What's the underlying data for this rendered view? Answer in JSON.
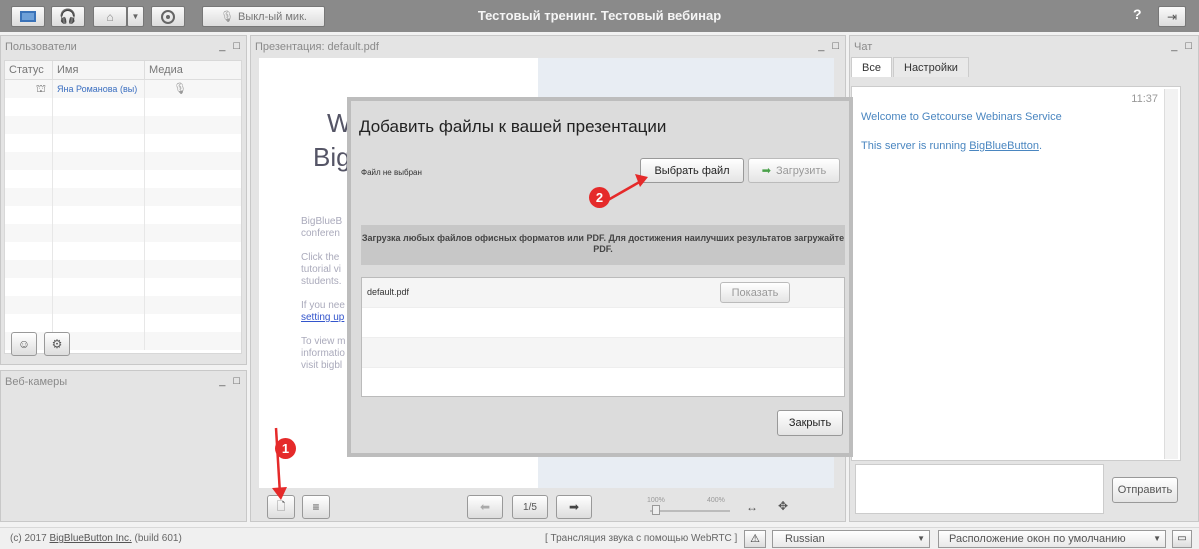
{
  "topbar": {
    "mic_button_label": "Выкл-ый мик.",
    "title": "Тестовый тренинг. Тестовый вебинар",
    "help_label": "?"
  },
  "users_panel": {
    "title": "Пользователи",
    "columns": [
      "Статус",
      "Имя",
      "Медиа"
    ],
    "rows": [
      {
        "name": "Яна Романова (вы)"
      }
    ]
  },
  "webcams_panel": {
    "title": "Веб-камеры"
  },
  "presentation_panel": {
    "title": "Презентация: default.pdf",
    "slide_heading_1": "W",
    "slide_heading_2": "Big",
    "slide_lines": [
      "BigBlueB",
      "conferen",
      "",
      "Click the",
      "tutorial vi",
      "students.",
      "",
      "If you nee",
      "setting up",
      "",
      "To view m",
      "informatio",
      "visit bigbl"
    ],
    "page_indicator": "1/5",
    "zoom_min": "100%",
    "zoom_max": "400%"
  },
  "chat_panel": {
    "title": "Чат",
    "tabs": [
      "Все",
      "Настройки"
    ],
    "timestamp": "11:37",
    "messages": [
      "Welcome to Getcourse Webinars Service",
      "This server is running "
    ],
    "link_text": "BigBlueButton",
    "link_suffix": ".",
    "send_label": "Отправить"
  },
  "modal": {
    "title": "Добавить файлы к вашей презентации",
    "file_status": "Файл не выбран",
    "choose_label": "Выбрать файл",
    "upload_label": "Загрузить",
    "info_text": "Загрузка любых файлов офисных форматов или PDF. Для достижения наилучших результатов загружайте PDF.",
    "files": [
      {
        "name": "default.pdf",
        "action": "Показать"
      }
    ],
    "close_label": "Закрыть"
  },
  "statusbar": {
    "copyright_prefix": "(c) 2017 ",
    "copyright_link": "BigBlueButton Inc.",
    "copyright_suffix": " (build 601)",
    "audio_text": "[ Трансляция звука с помощью WebRTC ]",
    "language": "Russian",
    "layout": "Расположение окон по умолчанию"
  },
  "annotations": {
    "badge_1": "1",
    "badge_2": "2"
  },
  "colors": {
    "accent_red": "#e52a2a",
    "topbar": "#8a8a8a",
    "link": "#4a86c0"
  }
}
